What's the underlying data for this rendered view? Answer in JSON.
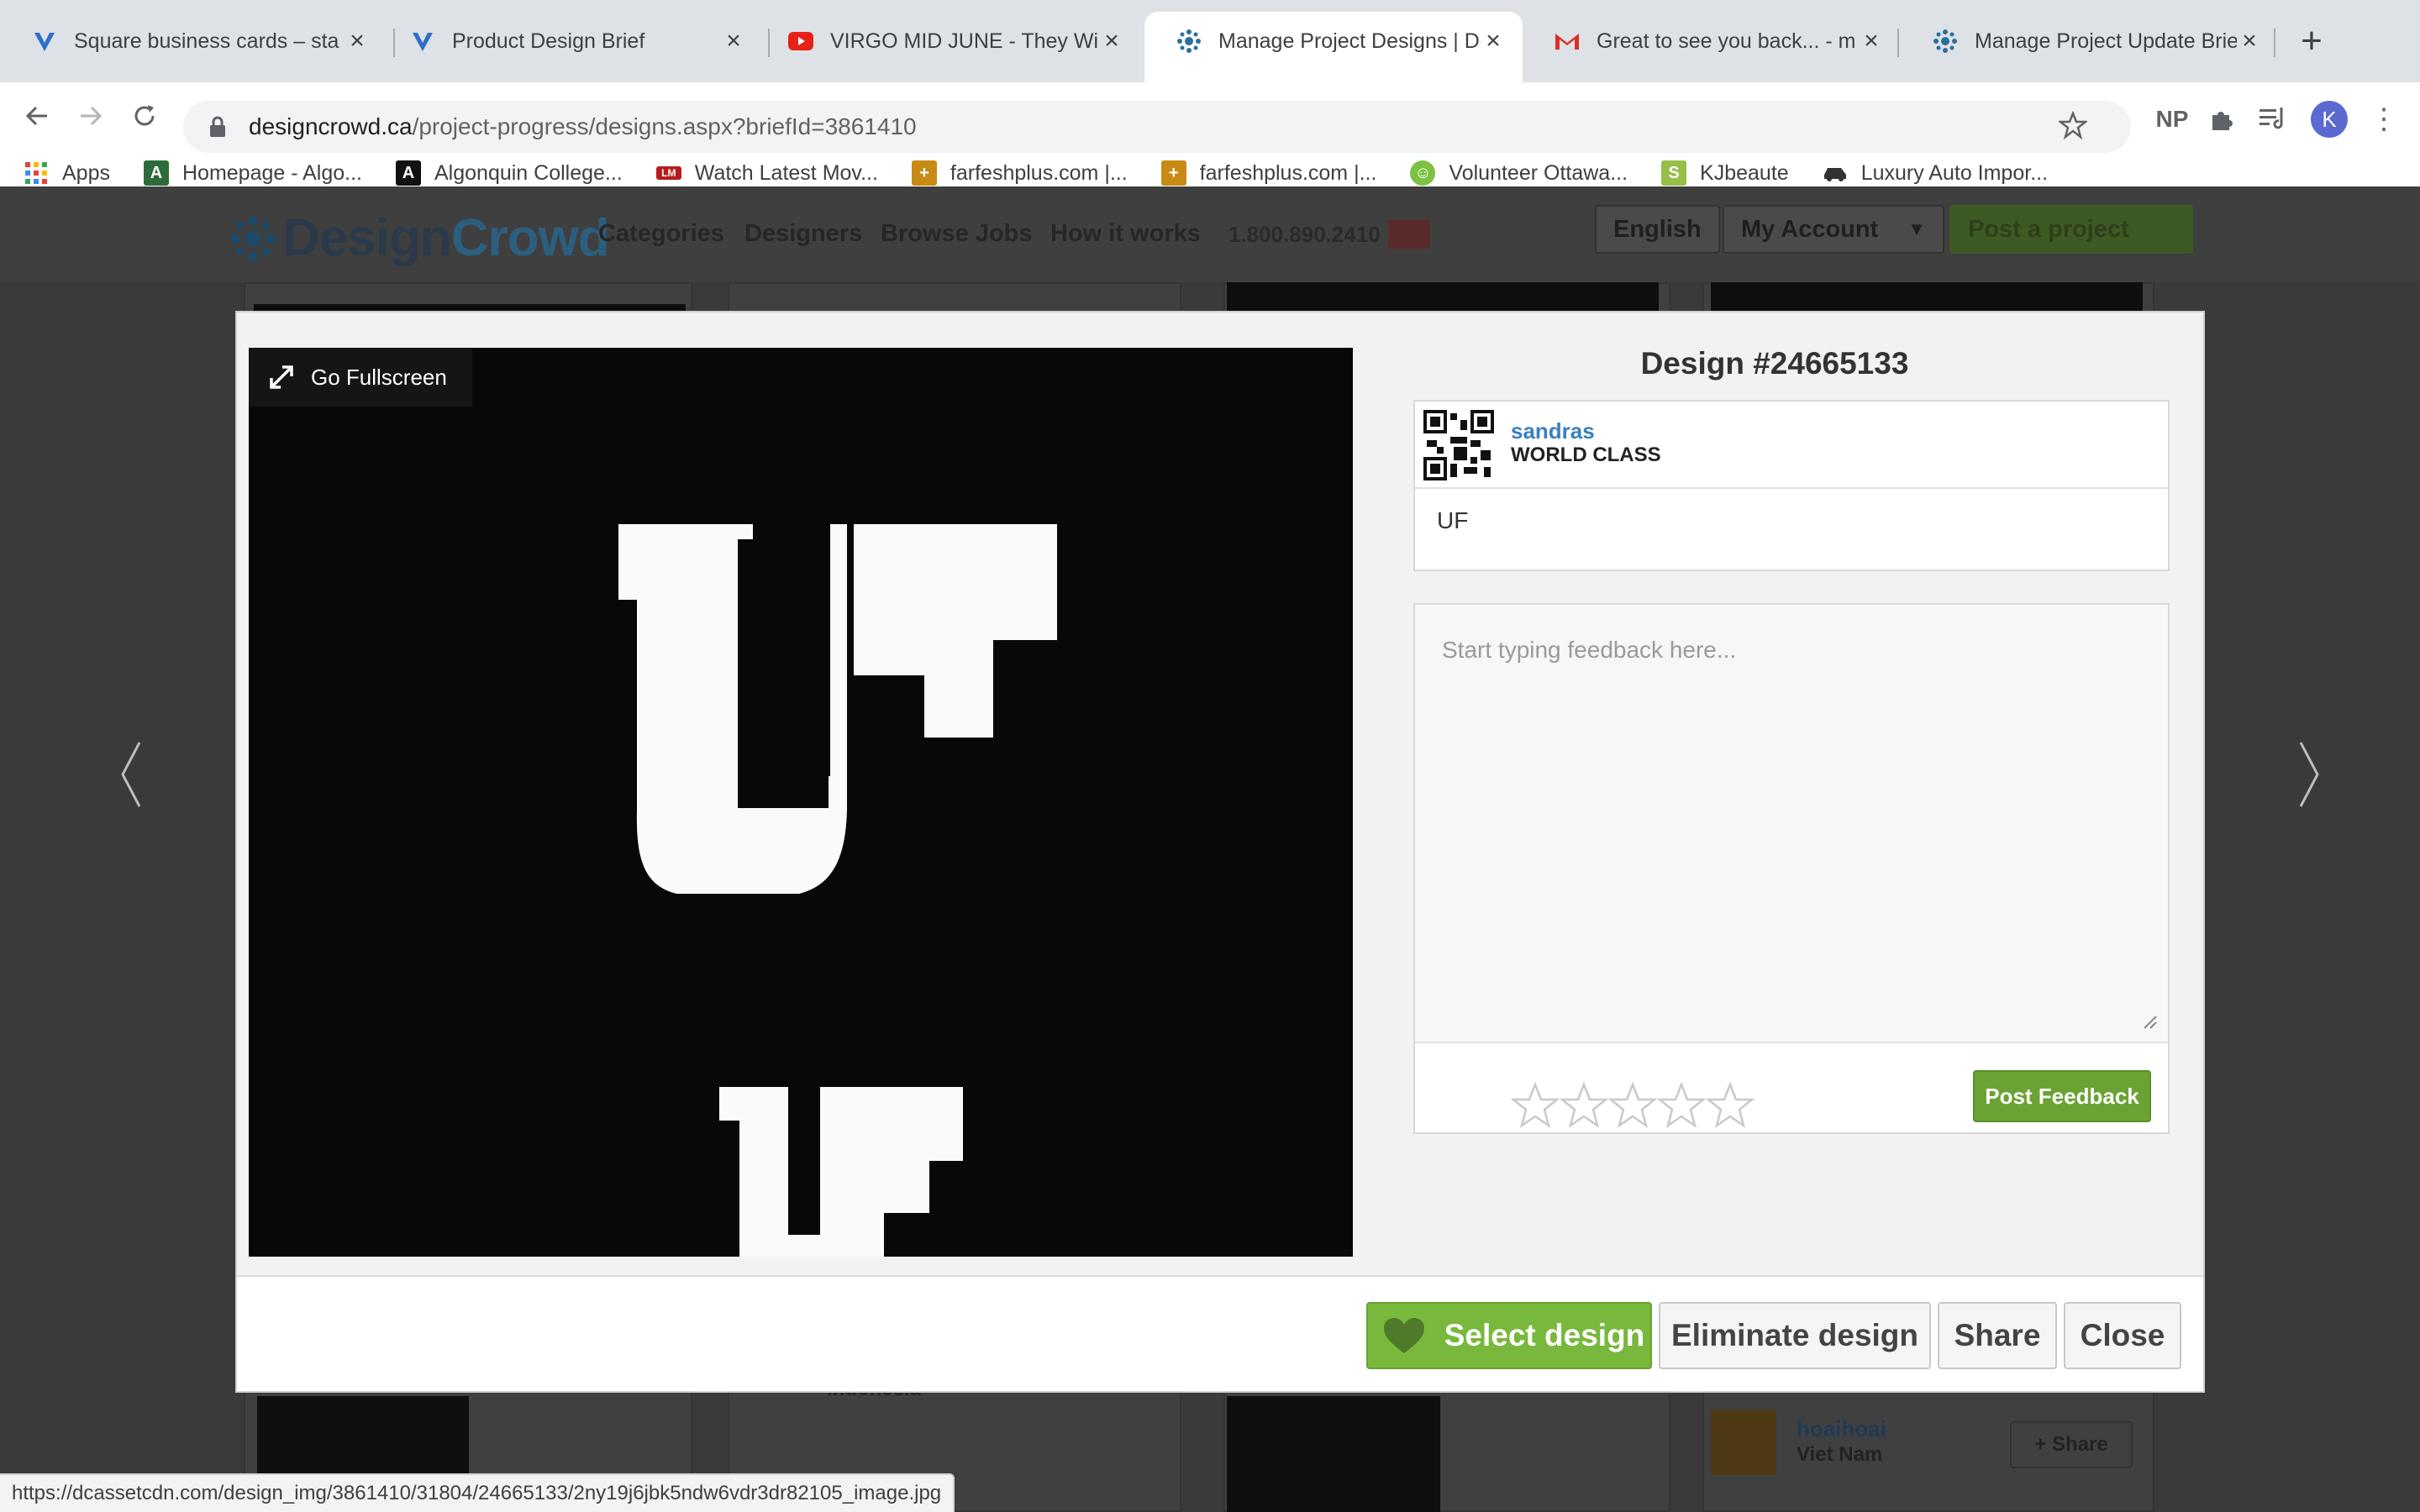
{
  "browser": {
    "tabs": [
      {
        "title": "Square business cards – sta",
        "icon": "vistaprint-icon",
        "active": false
      },
      {
        "title": "Product Design Brief",
        "icon": "vistaprint-icon",
        "active": false
      },
      {
        "title": "VIRGO MID JUNE - They Wi",
        "icon": "youtube-icon",
        "active": false
      },
      {
        "title": "Manage Project Designs | De",
        "icon": "designcrowd-icon",
        "active": true
      },
      {
        "title": "Great to see you back... - m",
        "icon": "gmail-icon",
        "active": false
      },
      {
        "title": "Manage Project Update Brie",
        "icon": "designcrowd-icon",
        "active": false
      }
    ],
    "url_host": "designcrowd.ca",
    "url_path": "/project-progress/designs.aspx?briefId=3861410",
    "profile_initial": "K",
    "bookmarks": [
      {
        "label": "Apps",
        "icon": "apps-grid-icon"
      },
      {
        "label": "Homepage - Algo...",
        "icon": "algonquin-icon"
      },
      {
        "label": "Algonquin College...",
        "icon": "algonquin-a-icon"
      },
      {
        "label": "Watch Latest Mov...",
        "icon": "movie-icon"
      },
      {
        "label": "farfeshplus.com |...",
        "icon": "farfesh-icon"
      },
      {
        "label": "farfeshplus.com |...",
        "icon": "farfesh-icon"
      },
      {
        "label": "Volunteer Ottawa...",
        "icon": "volunteer-icon"
      },
      {
        "label": "KJbeaute",
        "icon": "shopify-icon"
      },
      {
        "label": "Luxury Auto Impor...",
        "icon": "car-icon"
      }
    ],
    "status_url": "https://dcassetcdn.com/design_img/3861410/31804/24665133/2ny19j6jbk5ndw6vdr3dr82105_image.jpg"
  },
  "site": {
    "logo_part1": "Design",
    "logo_part2": "Crowd",
    "nav": [
      "Categories",
      "Designers",
      "Browse Jobs",
      "How it works"
    ],
    "phone": "1.800.890.2410",
    "language": "English",
    "account": "My Account",
    "post_project": "Post a project",
    "bg_designer_name": "hoaihoai",
    "bg_designer_country": "Viet Nam",
    "bg_country_left": "Indonesia",
    "bg_share": "+ Share"
  },
  "modal": {
    "fullscreen_label": "Go Fullscreen",
    "design_logo_text": "UF",
    "title": "Design #24665133",
    "designer_name": "sandras",
    "designer_level": "WORLD CLASS",
    "designer_comment": "UF",
    "feedback_placeholder": "Start typing feedback here...",
    "rating": 0,
    "rating_max": 5,
    "post_feedback": "Post Feedback",
    "select_design": "Select design",
    "eliminate_design": "Eliminate design",
    "share": "Share",
    "close": "Close"
  }
}
